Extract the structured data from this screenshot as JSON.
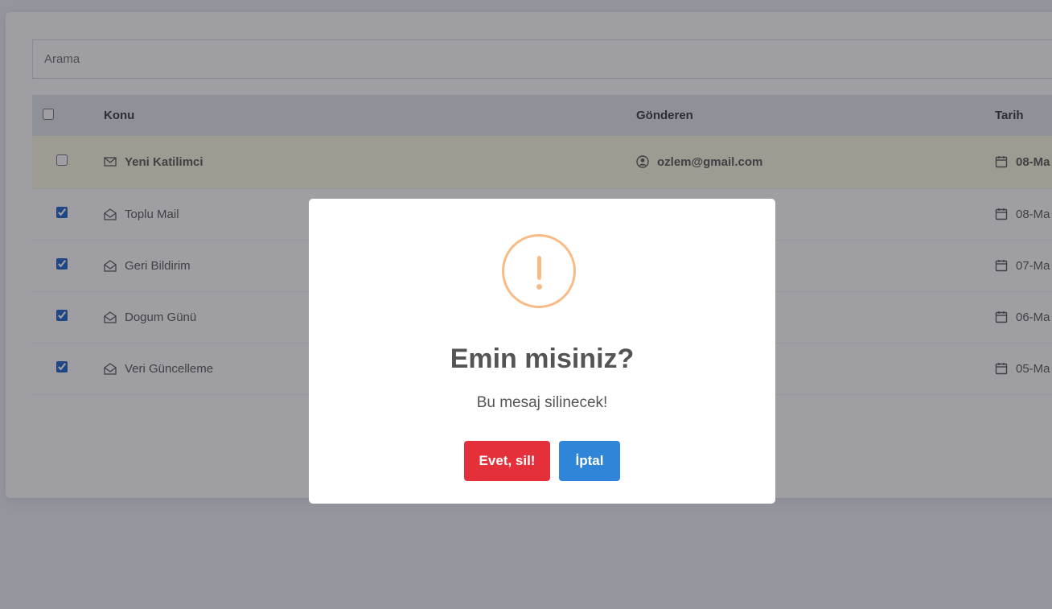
{
  "search": {
    "placeholder": "Arama"
  },
  "table": {
    "columns": {
      "subject": "Konu",
      "sender": "Gönderen",
      "date": "Tarih"
    },
    "rows": [
      {
        "selected": false,
        "unread": true,
        "subject": "Yeni Katilimci",
        "sender": "ozlem@gmail.com",
        "date": "08-Ma"
      },
      {
        "selected": true,
        "unread": false,
        "subject": "Toplu Mail",
        "sender": "",
        "date": "08-Ma"
      },
      {
        "selected": true,
        "unread": false,
        "subject": "Geri Bildirim",
        "sender": "",
        "date": "07-Ma"
      },
      {
        "selected": true,
        "unread": false,
        "subject": "Dogum Günü",
        "sender": "",
        "date": "06-Ma"
      },
      {
        "selected": true,
        "unread": false,
        "subject": "Veri Güncelleme",
        "sender": "",
        "date": "05-Ma"
      }
    ]
  },
  "dialog": {
    "title": "Emin misiniz?",
    "text": "Bu mesaj silinecek!",
    "confirm_label": "Evet, sil!",
    "cancel_label": "İptal"
  },
  "colors": {
    "warning": "#f8bb86",
    "confirm": "#e3303a",
    "cancel": "#2f86d8",
    "highlight_row": "#fffbe0"
  },
  "icons": {
    "subject_unread": "envelope-closed-icon",
    "subject_read": "envelope-open-icon",
    "sender": "user-circle-icon",
    "date": "calendar-icon",
    "dialog": "warning-icon"
  }
}
